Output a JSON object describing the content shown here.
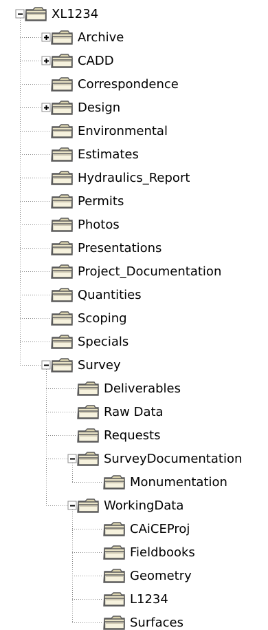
{
  "tree": {
    "label": "XL1234",
    "expanded": true,
    "children": [
      {
        "label": "Archive",
        "expandable": true,
        "expanded": false
      },
      {
        "label": "CADD",
        "expandable": true,
        "expanded": false
      },
      {
        "label": "Correspondence"
      },
      {
        "label": "Design",
        "expandable": true,
        "expanded": false
      },
      {
        "label": "Environmental"
      },
      {
        "label": "Estimates"
      },
      {
        "label": "Hydraulics_Report"
      },
      {
        "label": "Permits"
      },
      {
        "label": "Photos"
      },
      {
        "label": "Presentations"
      },
      {
        "label": "Project_Documentation"
      },
      {
        "label": "Quantities"
      },
      {
        "label": "Scoping"
      },
      {
        "label": "Specials"
      },
      {
        "label": "Survey",
        "expandable": true,
        "expanded": true,
        "children": [
          {
            "label": "Deliverables"
          },
          {
            "label": "Raw Data"
          },
          {
            "label": "Requests"
          },
          {
            "label": "SurveyDocumentation",
            "expandable": true,
            "expanded": true,
            "children": [
              {
                "label": "Monumentation"
              }
            ]
          },
          {
            "label": "WorkingData",
            "expandable": true,
            "expanded": true,
            "children": [
              {
                "label": "CAiCEProj"
              },
              {
                "label": "Fieldbooks"
              },
              {
                "label": "Geometry"
              },
              {
                "label": "L1234"
              },
              {
                "label": "Surfaces"
              }
            ]
          }
        ]
      }
    ]
  },
  "icons": {
    "expanded": "minus-box",
    "collapsed": "plus-box",
    "folder": "folder-icon"
  }
}
